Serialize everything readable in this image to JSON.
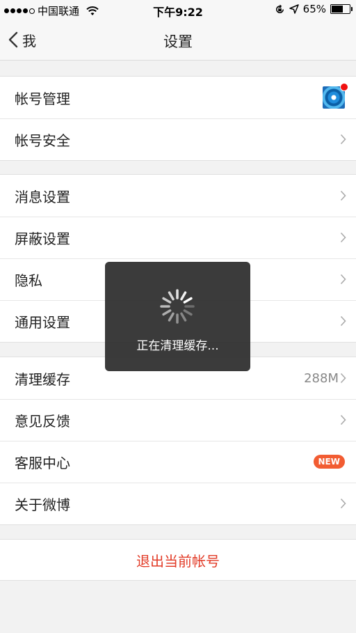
{
  "status_bar": {
    "carrier": "中国联通",
    "time": "下午9:22",
    "battery_text": "65%",
    "battery_level": 0.65,
    "signal_bars_filled": 4,
    "signal_bars_total": 5,
    "icons": [
      "signal-dots-icon",
      "wifi-icon",
      "orientation-lock-icon",
      "location-icon",
      "battery-icon"
    ]
  },
  "navbar": {
    "back_label": "我",
    "title": "设置"
  },
  "groups": [
    {
      "items": [
        {
          "label": "帐号管理",
          "accessory": "avatar",
          "has_red_dot": true
        },
        {
          "label": "帐号安全",
          "accessory": "chevron"
        }
      ]
    },
    {
      "items": [
        {
          "label": "消息设置",
          "accessory": "chevron"
        },
        {
          "label": "屏蔽设置",
          "accessory": "chevron"
        },
        {
          "label": "隐私",
          "accessory": "chevron"
        },
        {
          "label": "通用设置",
          "accessory": "chevron"
        }
      ]
    },
    {
      "items": [
        {
          "label": "清理缓存",
          "value": "288M",
          "accessory": "chevron"
        },
        {
          "label": "意见反馈",
          "accessory": "chevron"
        },
        {
          "label": "客服中心",
          "badge": "NEW"
        },
        {
          "label": "关于微博",
          "accessory": "chevron"
        }
      ]
    }
  ],
  "logout": {
    "label": "退出当前帐号"
  },
  "toast": {
    "text": "正在清理缓存..."
  },
  "colors": {
    "logout": "#e23b27",
    "badge": "#f25c32",
    "red_dot": "#f01010",
    "toast_bg": "#2c2c2c"
  }
}
